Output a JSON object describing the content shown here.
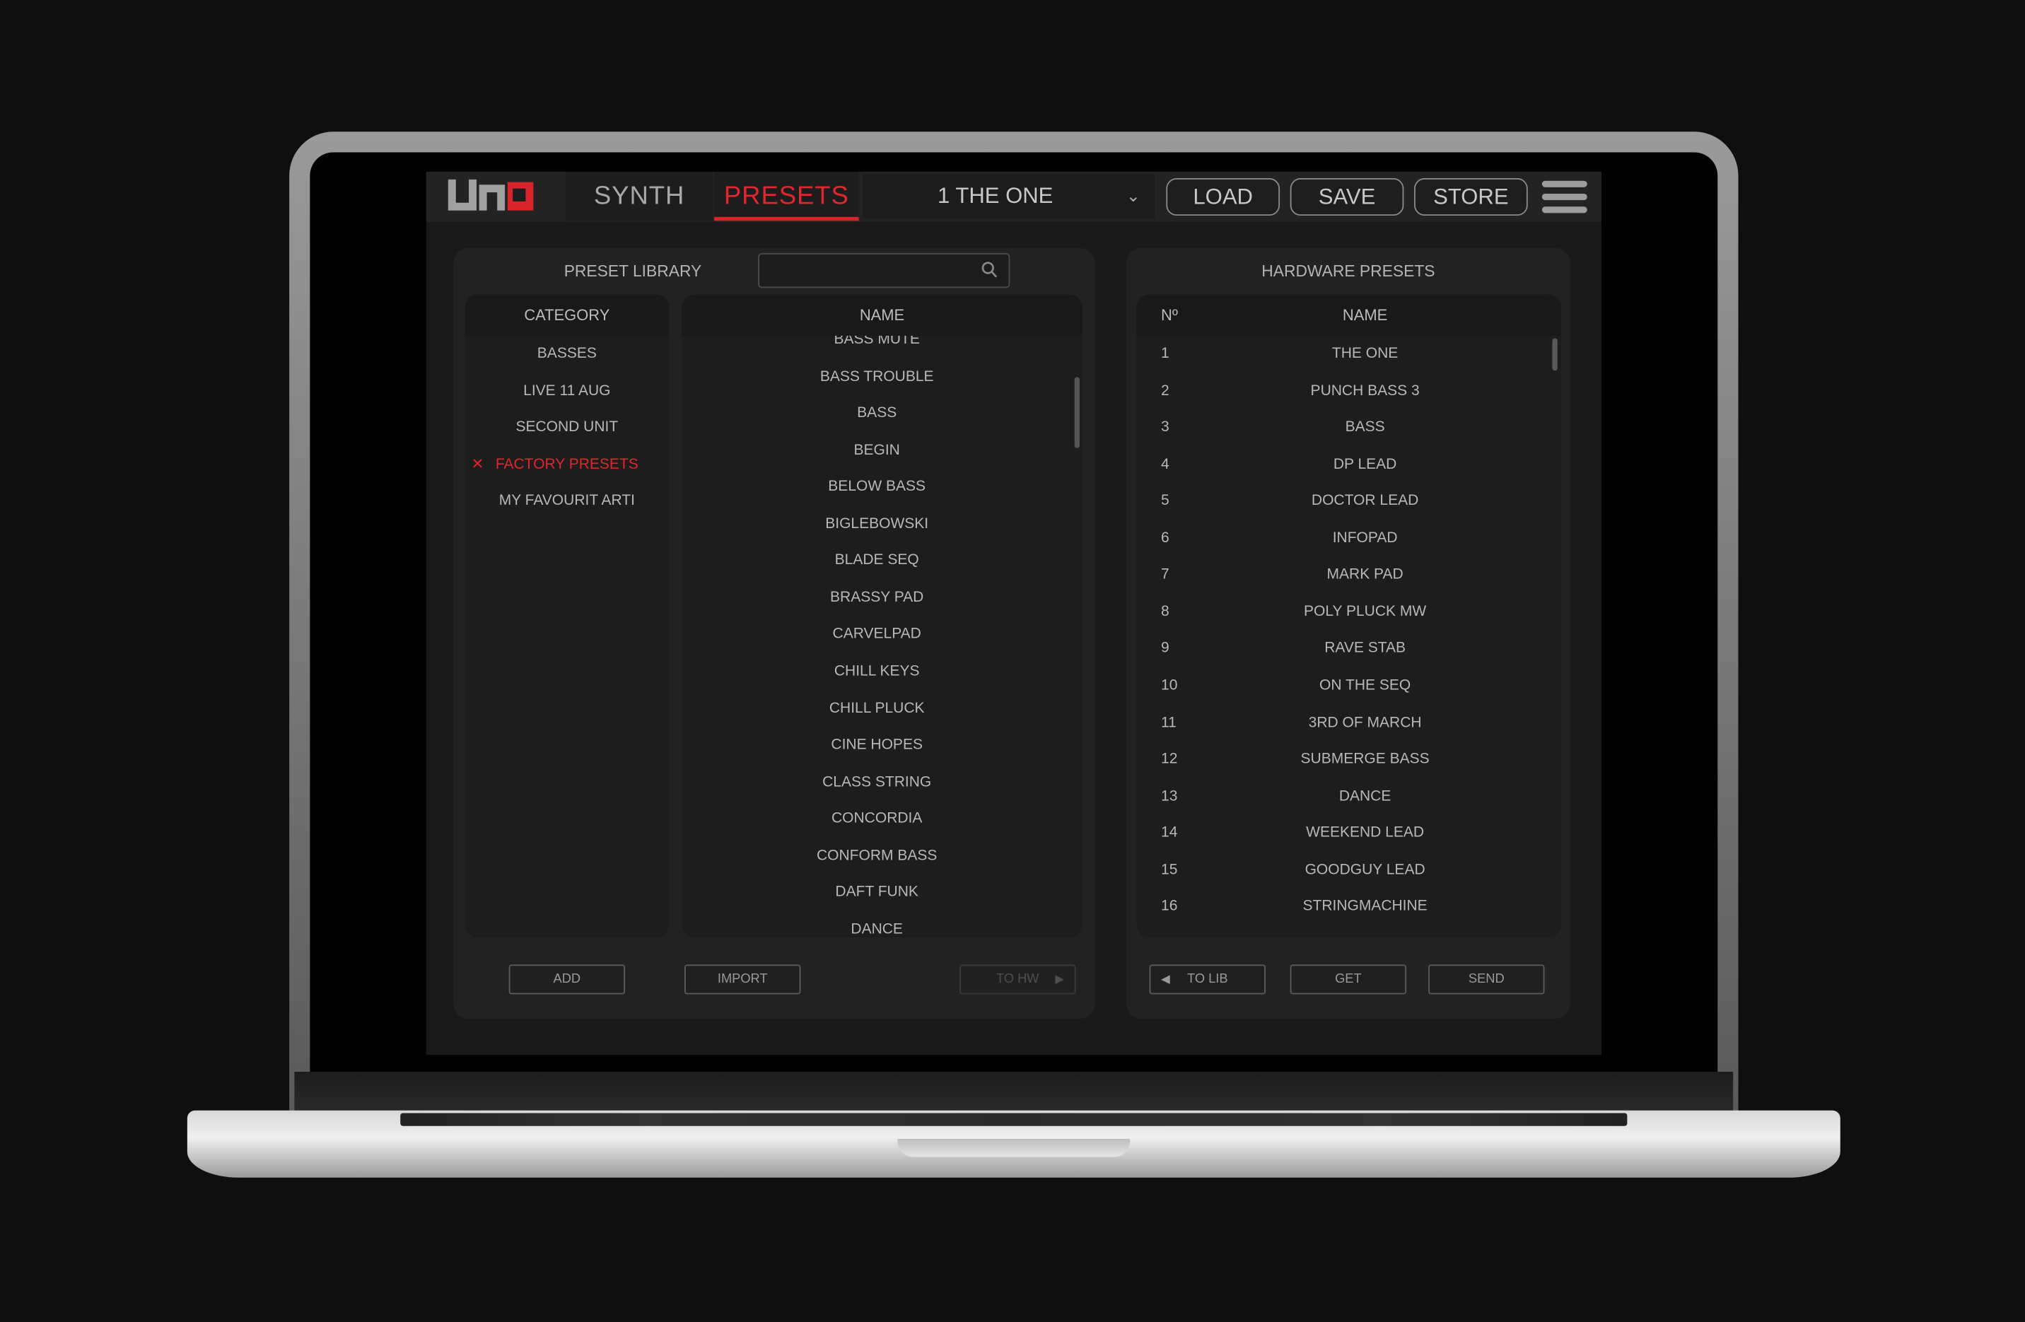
{
  "app": {
    "logo": "UNO"
  },
  "tabs": [
    {
      "label": "SYNTH",
      "active": false
    },
    {
      "label": "PRESETS",
      "active": true
    }
  ],
  "preset_select": {
    "value": "1 THE ONE",
    "icon": "chevron-down-icon"
  },
  "toolbar": {
    "load": "LOAD",
    "save": "SAVE",
    "store": "STORE",
    "menu_icon": "hamburger-icon"
  },
  "library": {
    "title": "PRESET LIBRARY",
    "search": {
      "value": "",
      "icon": "search-icon"
    },
    "category_header": "CATEGORY",
    "categories": [
      {
        "label": "BASSES",
        "selected": false
      },
      {
        "label": "LIVE 11 AUG",
        "selected": false
      },
      {
        "label": "SECOND UNIT",
        "selected": false
      },
      {
        "label": "FACTORY PRESETS",
        "selected": true
      },
      {
        "label": "MY FAVOURIT ARTI",
        "selected": false
      }
    ],
    "name_header": "NAME",
    "names": [
      "BASS MUTE",
      "BASS TROUBLE",
      "BASS",
      "BEGIN",
      "BELOW BASS",
      "BIGLEBOWSKI",
      "BLADE SEQ",
      "BRASSY PAD",
      "CARVELPAD",
      "CHILL KEYS",
      "CHILL PLUCK",
      "CINE HOPES",
      "CLASS STRING",
      "CONCORDIA",
      "CONFORM BASS",
      "DAFT FUNK",
      "DANCE"
    ],
    "buttons": {
      "add": "ADD",
      "import": "IMPORT",
      "to_hw": "TO HW"
    }
  },
  "hardware": {
    "title": "HARDWARE PRESETS",
    "num_header": "Nº",
    "name_header": "NAME",
    "rows": [
      {
        "n": "1",
        "name": "THE ONE"
      },
      {
        "n": "2",
        "name": "PUNCH BASS 3"
      },
      {
        "n": "3",
        "name": "BASS"
      },
      {
        "n": "4",
        "name": "DP LEAD"
      },
      {
        "n": "5",
        "name": "DOCTOR LEAD"
      },
      {
        "n": "6",
        "name": "INFOPAD"
      },
      {
        "n": "7",
        "name": "MARK PAD"
      },
      {
        "n": "8",
        "name": "POLY PLUCK MW"
      },
      {
        "n": "9",
        "name": "RAVE STAB"
      },
      {
        "n": "10",
        "name": "ON THE SEQ"
      },
      {
        "n": "11",
        "name": "3RD OF MARCH"
      },
      {
        "n": "12",
        "name": "SUBMERGE BASS"
      },
      {
        "n": "13",
        "name": "DANCE"
      },
      {
        "n": "14",
        "name": "WEEKEND LEAD"
      },
      {
        "n": "15",
        "name": "GOODGUY LEAD"
      },
      {
        "n": "16",
        "name": "STRINGMACHINE"
      }
    ],
    "buttons": {
      "to_lib": "TO LIB",
      "get": "GET",
      "send": "SEND"
    }
  },
  "colors": {
    "accent": "#d8242b",
    "background": "#191919"
  }
}
